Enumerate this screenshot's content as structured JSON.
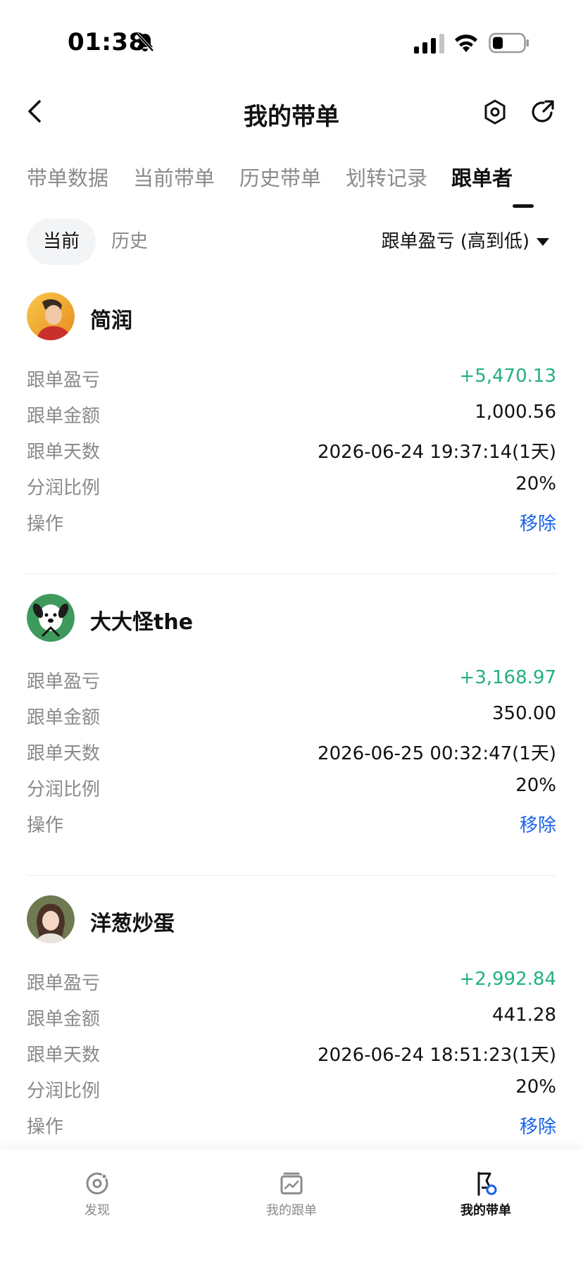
{
  "status": {
    "time": "01:38"
  },
  "nav": {
    "title": "我的带单"
  },
  "tabs": [
    "带单数据",
    "当前带单",
    "历史带单",
    "划转记录",
    "跟单者"
  ],
  "filters": {
    "current": "当前",
    "history": "历史",
    "sort": "跟单盈亏 (高到低)"
  },
  "followers": [
    {
      "name": "简润",
      "rows": [
        {
          "label": "跟单盈亏",
          "value": "+5,470.13"
        },
        {
          "label": "跟单金额",
          "value": "1,000.56"
        },
        {
          "label": "跟单天数",
          "value": "2026-06-24 19:37:14(1天)"
        },
        {
          "label": "分润比例",
          "value": "20%"
        },
        {
          "label": "操作",
          "value": "移除"
        }
      ]
    },
    {
      "name": "大大怪the",
      "rows": [
        {
          "label": "跟单盈亏",
          "value": "+3,168.97"
        },
        {
          "label": "跟单金额",
          "value": "350.00"
        },
        {
          "label": "跟单天数",
          "value": "2026-06-25 00:32:47(1天)"
        },
        {
          "label": "分润比例",
          "value": "20%"
        },
        {
          "label": "操作",
          "value": "移除"
        }
      ]
    },
    {
      "name": "洋葱炒蛋",
      "rows": [
        {
          "label": "跟单盈亏",
          "value": "+2,992.84"
        },
        {
          "label": "跟单金额",
          "value": "441.28"
        },
        {
          "label": "跟单天数",
          "value": "2026-06-24 18:51:23(1天)"
        },
        {
          "label": "分润比例",
          "value": "20%"
        },
        {
          "label": "操作",
          "value": "移除"
        }
      ]
    }
  ],
  "bottom_nav": [
    "发现",
    "我的跟单",
    "我的带单"
  ],
  "colors": {
    "profit": "#22b07d",
    "link": "#1a63e8",
    "muted": "#8a8a8a"
  }
}
